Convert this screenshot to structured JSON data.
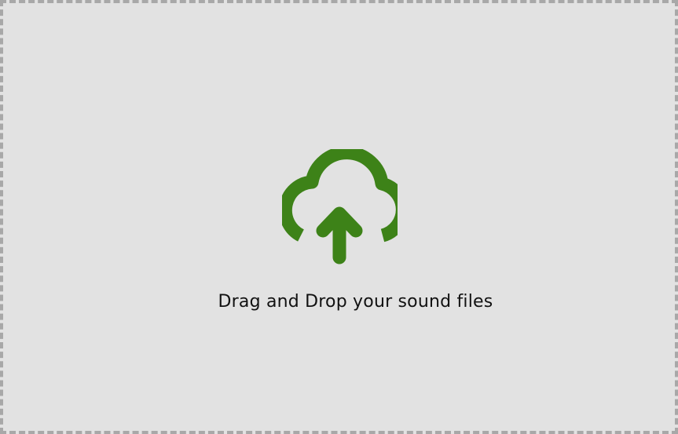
{
  "dropzone": {
    "label": "Drag and Drop your sound files",
    "icon": "cloud-upload-icon"
  },
  "colors": {
    "background": "#e2e2e2",
    "border": "#a8a8a8",
    "icon": "#3d8218",
    "text": "#111111"
  }
}
